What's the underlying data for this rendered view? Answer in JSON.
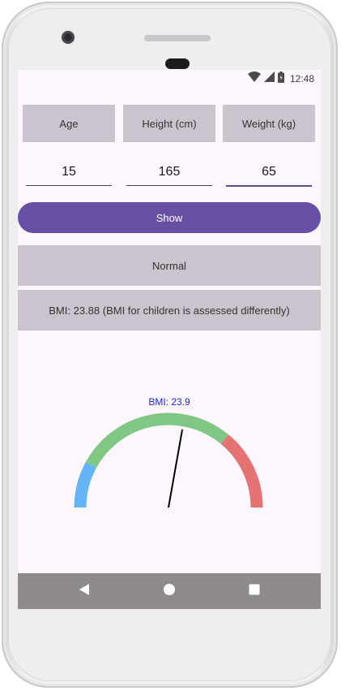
{
  "status_bar": {
    "time": "12:48",
    "icons": [
      "wifi-icon",
      "signal-icon",
      "battery-icon"
    ]
  },
  "labels": {
    "age": "Age",
    "height": "Height (cm)",
    "weight": "Weight (kg)"
  },
  "inputs": {
    "age": "15",
    "height": "165",
    "weight": "65"
  },
  "show_button": {
    "label": "Show"
  },
  "category_text": "Normal",
  "bmi_text": "BMI: 23.88 (BMI for children is assessed differently)",
  "gauge": {
    "label": "BMI: 23.9",
    "value": 23.9,
    "min": 10,
    "max": 35,
    "zones": [
      {
        "name": "underweight",
        "from": 10,
        "to": 14,
        "color": "#64b5f6"
      },
      {
        "name": "normal",
        "from": 14,
        "to": 28,
        "color": "#81c784"
      },
      {
        "name": "overweight",
        "from": 28,
        "to": 35,
        "color": "#e57373"
      }
    ],
    "label_color": "#1a25d6"
  },
  "nav_bar": {
    "buttons": [
      "back-icon",
      "home-icon",
      "recents-icon"
    ]
  },
  "colors": {
    "accent": "#6750a4",
    "surface": "#fdf6fd",
    "box": "#cbc4cf"
  }
}
